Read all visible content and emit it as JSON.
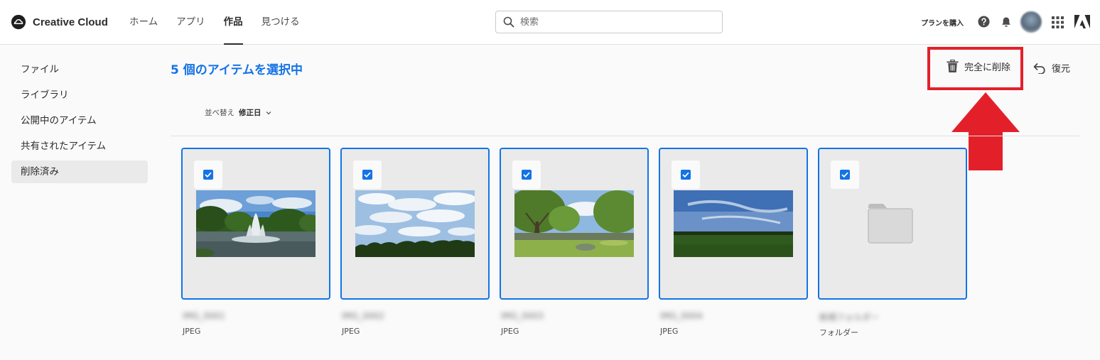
{
  "header": {
    "brand_name": "Creative Cloud",
    "nav": [
      {
        "label": "ホーム",
        "active": false
      },
      {
        "label": "アプリ",
        "active": false
      },
      {
        "label": "作品",
        "active": true
      },
      {
        "label": "見つける",
        "active": false
      }
    ],
    "search_placeholder": "検索",
    "buy_plan_label": "プランを購入"
  },
  "sidebar": {
    "items": [
      {
        "label": "ファイル",
        "active": false
      },
      {
        "label": "ライブラリ",
        "active": false
      },
      {
        "label": "公開中のアイテム",
        "active": false
      },
      {
        "label": "共有されたアイテム",
        "active": false
      },
      {
        "label": "削除済み",
        "active": true
      }
    ]
  },
  "main": {
    "selection_title": "5 個のアイテムを選択中",
    "actions": {
      "delete_permanently_label": "完全に削除",
      "restore_label": "復元"
    },
    "sort": {
      "label": "並べ替え",
      "value": "修正日"
    },
    "items": [
      {
        "name": "IMG_0001",
        "type": "JPEG",
        "selected": true,
        "thumbnail": "fountain"
      },
      {
        "name": "IMG_0002",
        "type": "JPEG",
        "selected": true,
        "thumbnail": "sky"
      },
      {
        "name": "IMG_0003",
        "type": "JPEG",
        "selected": true,
        "thumbnail": "park"
      },
      {
        "name": "IMG_0004",
        "type": "JPEG",
        "selected": true,
        "thumbnail": "field"
      },
      {
        "name": "新規フォルダー",
        "type": "フォルダー",
        "selected": true,
        "thumbnail": "folder"
      }
    ]
  },
  "colors": {
    "accent": "#1473e6",
    "annotation": "#e3202a"
  }
}
